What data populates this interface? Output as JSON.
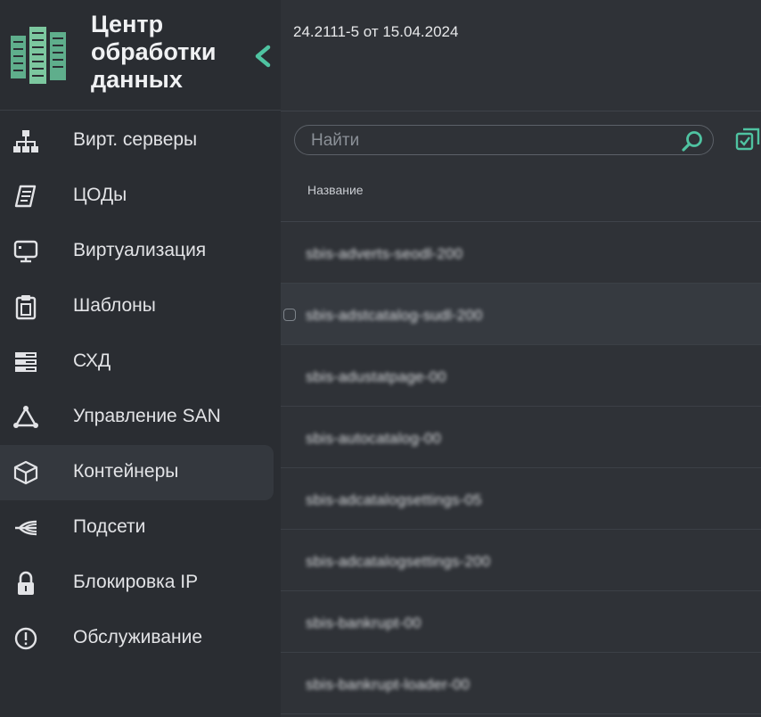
{
  "brand": {
    "title_lines": [
      "Центр",
      "обработки",
      "данных"
    ],
    "logo_icon": "server-rack-icon",
    "collapse_icon": "chevron-left-icon"
  },
  "header": {
    "version": "24.2111-5 от 15.04.2024"
  },
  "nav": {
    "items": [
      {
        "label": "Вирт. серверы",
        "icon": "network-icon",
        "active": false
      },
      {
        "label": "ЦОДы",
        "icon": "scroll-icon",
        "active": false
      },
      {
        "label": "Виртуализация",
        "icon": "monitor-icon",
        "active": false
      },
      {
        "label": "Шаблоны",
        "icon": "clipboard-icon",
        "active": false
      },
      {
        "label": "СХД",
        "icon": "storage-icon",
        "active": false
      },
      {
        "label": "Управление SAN",
        "icon": "triangle-nodes-icon",
        "active": false
      },
      {
        "label": "Контейнеры",
        "icon": "cube-icon",
        "active": true
      },
      {
        "label": "Подсети",
        "icon": "subnet-icon",
        "active": false
      },
      {
        "label": "Блокировка IP",
        "icon": "lock-icon",
        "active": false
      },
      {
        "label": "Обслуживание",
        "icon": "alert-circle-icon",
        "active": false
      }
    ]
  },
  "search": {
    "placeholder": "Найти",
    "value": ""
  },
  "table": {
    "column": "Название",
    "rows": [
      "sbis-adverts-seodl-200",
      "sbis-adstcatalog-sudl-200",
      "sbis-adustatpage-00",
      "sbis-autocatalog-00",
      "sbis-adcatalogsettings-05",
      "sbis-adcatalogsettings-200",
      "sbis-bankrupt-00",
      "sbis-bankrupt-loader-00"
    ]
  },
  "colors": {
    "accent": "#4fc3a1",
    "sidebar_bg": "#2a2d32",
    "main_bg": "#2f3237",
    "active_bg": "#34383e"
  }
}
